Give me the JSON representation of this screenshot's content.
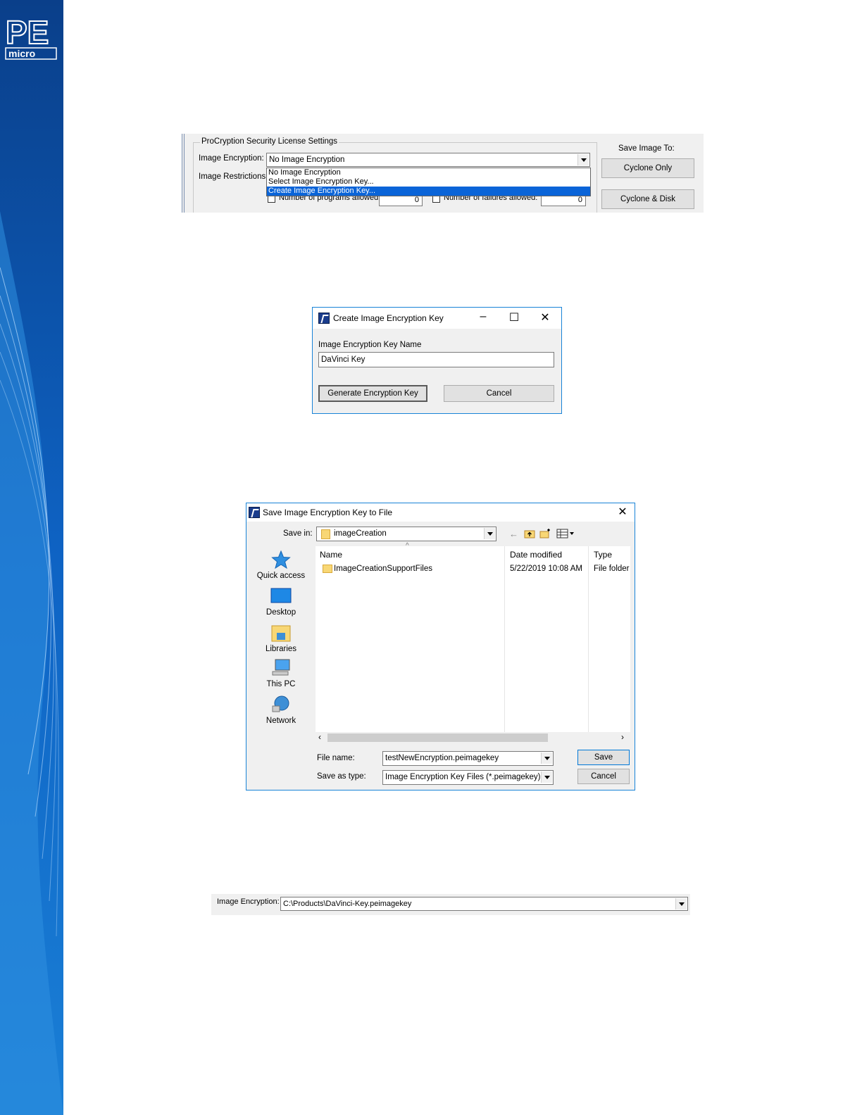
{
  "brand": {
    "logo_text": "PE micro"
  },
  "colors": {
    "band_dark": "#0a3f8a",
    "band_light": "#2f8fe0",
    "accent": "#0a64d8",
    "window_border": "#1883d7"
  },
  "shot1": {
    "group_title": "ProCryption Security License Settings",
    "encryption_label": "Image Encryption:",
    "restrictions_label": "Image Restrictions :",
    "combo_value": "No Image Encryption",
    "options": [
      "No Image Encryption",
      "Select Image Encryption Key...",
      "Create Image Encryption Key..."
    ],
    "selected_option": "Create Image Encryption Key...",
    "programs_label": "Number of programs allowed:",
    "programs_value": "0",
    "failures_label": "Number of failures allowed:",
    "failures_value": "0",
    "save_to_label": "Save Image To:",
    "btn_cyclone_only": "Cyclone Only",
    "btn_cyclone_disk": "Cyclone & Disk"
  },
  "shot2": {
    "title": "Create Image Encryption Key",
    "minimize": "–",
    "maximize": "☐",
    "close": "✕",
    "field_label": "Image Encryption Key Name",
    "field_value": "DaVinci Key",
    "btn_generate": "Generate Encryption Key",
    "btn_cancel": "Cancel"
  },
  "shot3": {
    "title": "Save Image Encryption Key to File",
    "close": "✕",
    "save_in_label": "Save in:",
    "save_in_value": "imageCreation",
    "places": [
      "Quick access",
      "Desktop",
      "Libraries",
      "This PC",
      "Network"
    ],
    "columns": [
      "Name",
      "Date modified",
      "Type"
    ],
    "rows": [
      {
        "name": "ImageCreationSupportFiles",
        "date": "5/22/2019 10:08 AM",
        "type": "File folder"
      }
    ],
    "file_name_label": "File name:",
    "file_name_value": "testNewEncryption.peimagekey",
    "save_type_label": "Save as type:",
    "save_type_value": "Image Encryption Key Files (*.peimagekey)",
    "btn_save": "Save",
    "btn_cancel": "Cancel"
  },
  "shot4": {
    "label": "Image Encryption:",
    "value": "C:\\Products\\DaVinci-Key.peimagekey"
  }
}
